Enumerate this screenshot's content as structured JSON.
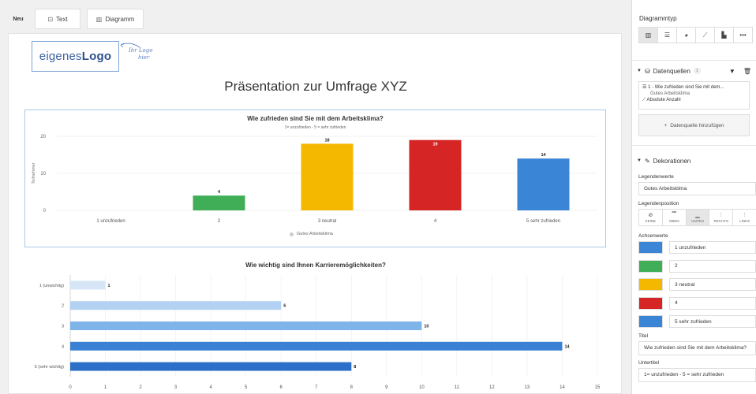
{
  "toolbar": {
    "new_label": "Neu",
    "text_label": "Text",
    "diagram_label": "Diagramm"
  },
  "logo": {
    "text_normal": "eigenes",
    "text_bold": "Logo",
    "handwritten_line1": "Ihr Logo",
    "handwritten_line2": "hier"
  },
  "presentation_title": "Präsentation zur Umfrage XYZ",
  "chart_data": [
    {
      "type": "bar",
      "title": "Wie zufrieden sind Sie mit dem Arbeitsklima?",
      "subtitle": "1= unzufrieden - 5 = sehr zufrieden",
      "ylabel": "Teilnehmer",
      "xlabel": "",
      "categories": [
        "1 unzufrieden",
        "2",
        "3 neutral",
        "4",
        "5 sehr zufrieden"
      ],
      "values": [
        0,
        4,
        18,
        19,
        14
      ],
      "data_labels": [
        "",
        "4",
        "18",
        "19",
        "14"
      ],
      "colors": [
        "#3a85d6",
        "#3fae57",
        "#f4b800",
        "#d52525",
        "#3a85d6"
      ],
      "ylim": [
        0,
        20
      ],
      "yticks": [
        "0",
        "10",
        "20"
      ],
      "grid": true,
      "legend": {
        "position": "bottom",
        "entries": [
          "Gutes Arbeitsklima"
        ]
      }
    },
    {
      "type": "bar",
      "orientation": "horizontal",
      "title": "Wie wichtig sind Ihnen Karrieremöglichkeiten?",
      "categories": [
        "1 (unwichtig)",
        "2",
        "3",
        "4",
        "5 (sehr wichtig)"
      ],
      "values": [
        1,
        6,
        10,
        14,
        8
      ],
      "data_labels": [
        "1",
        "6",
        "10",
        "14",
        "8"
      ],
      "colors": [
        "#d6e6f7",
        "#b3d1f2",
        "#7fb4ea",
        "#3a80d4",
        "#2b6fc8"
      ],
      "xlim": [
        0,
        15
      ],
      "xticks": [
        "0",
        "1",
        "2",
        "3",
        "4",
        "5",
        "6",
        "7",
        "8",
        "9",
        "10",
        "11",
        "12",
        "13",
        "14",
        "15"
      ],
      "grid": true
    }
  ],
  "panel": {
    "charttype_title": "Diagrammtyp",
    "chart_types": [
      {
        "icon": "bar-chart-icon",
        "glyph": "▥"
      },
      {
        "icon": "horizontal-bar-icon",
        "glyph": "☰"
      },
      {
        "icon": "pie-chart-icon",
        "glyph": "◕"
      },
      {
        "icon": "line-chart-icon",
        "glyph": "⟋"
      },
      {
        "icon": "stacked-bar-icon",
        "glyph": "▙"
      },
      {
        "icon": "more-icon",
        "glyph": "•••"
      }
    ],
    "datasources_title": "Datenquellen",
    "datasources_count": "1",
    "datasource": {
      "line1": "1 - Wie zufrieden sind Sie mit dem...",
      "line2": "Gutes Arbeitsklima",
      "line3": "Absolute Anzahl"
    },
    "add_datasource": "Datenquelle hinzufügen",
    "decorations_title": "Dekorationen",
    "legend_values_label": "Legendenwerte",
    "legend_values_value": "Gutes Arbeitsklima",
    "legend_position_label": "Legendenposition",
    "legend_positions": [
      {
        "label": "KEINE",
        "glyph": "⊘"
      },
      {
        "label": "OBEN",
        "glyph": "▔"
      },
      {
        "label": "UNTEN",
        "glyph": "▁"
      },
      {
        "label": "RECHTS",
        "glyph": "⫶"
      },
      {
        "label": "LINKS",
        "glyph": "⫶"
      }
    ],
    "axis_values_label": "Achsenwerte",
    "axis_values": [
      {
        "label": "1 unzufrieden",
        "color": "#3a85d6"
      },
      {
        "label": "2",
        "color": "#3fae57"
      },
      {
        "label": "3 neutral",
        "color": "#f4b800"
      },
      {
        "label": "4",
        "color": "#d52525"
      },
      {
        "label": "5 sehr zufrieden",
        "color": "#3a85d6"
      }
    ],
    "title_label": "Titel",
    "title_value": "Wie zufrieden sind Sie mit dem Arbeitsklima?",
    "subtitle_label": "Untertitel",
    "subtitle_value": "1= unzufrieden - 5 = sehr zufrieden"
  }
}
